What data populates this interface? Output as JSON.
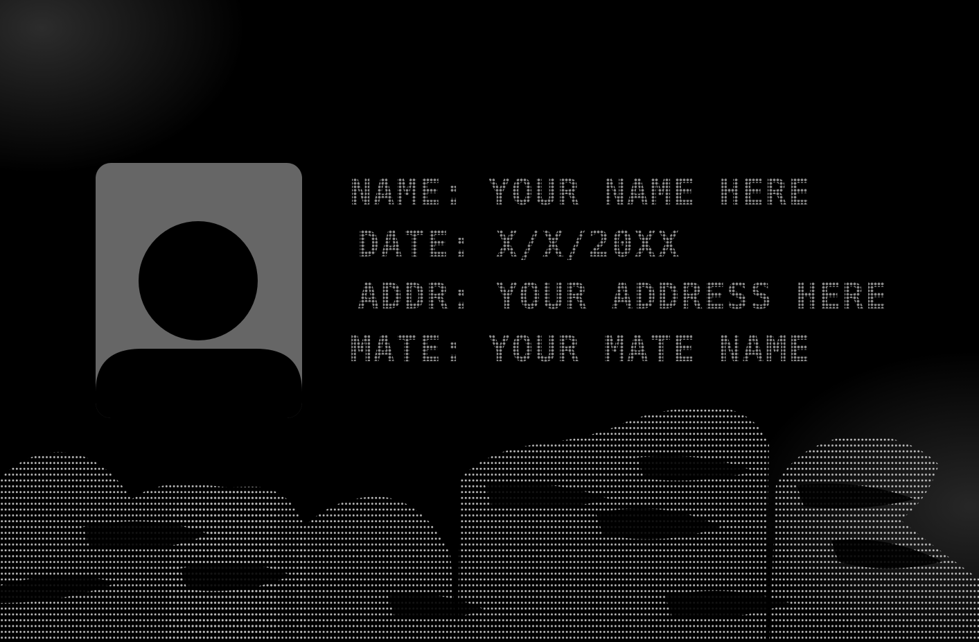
{
  "fields": [
    {
      "label": "NAME:",
      "value": "YOUR NAME HERE"
    },
    {
      "label": "DATE:",
      "value": "X/X/20XX"
    },
    {
      "label": "ADDR:",
      "value": "YOUR ADDRESS HERE"
    },
    {
      "label": "MATE:",
      "value": "YOUR MATE NAME"
    }
  ],
  "avatar": {
    "icon": "user-silhouette-icon"
  },
  "colors": {
    "background": "#000000",
    "avatar_frame": "#666666",
    "dot_text": "#8a8a8a",
    "halftone_dots": "#bdbdbd"
  }
}
